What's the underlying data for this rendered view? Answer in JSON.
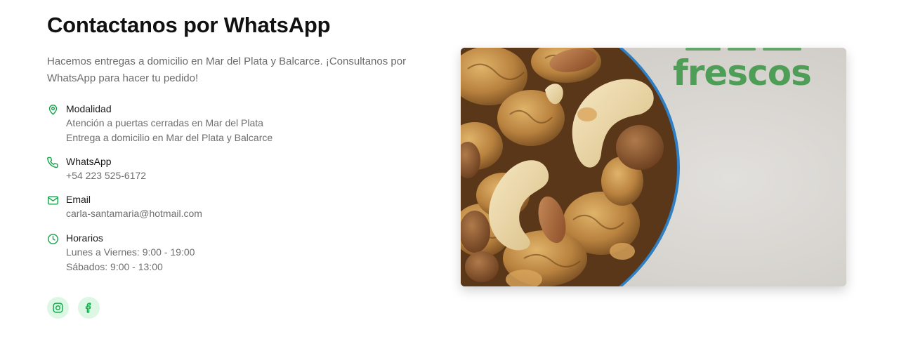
{
  "contact": {
    "title": "Contactanos por WhatsApp",
    "intro": "Hacemos entregas a domicilio en Mar del Plata y Balcarce. ¡Consultanos por WhatsApp para hacer tu pedido!",
    "items": [
      {
        "icon": "map-pin-icon",
        "label": "Modalidad",
        "lines": [
          "Atención a puertas cerradas en Mar del Plata",
          "Entrega a domicilio en Mar del Plata y Balcarce"
        ]
      },
      {
        "icon": "phone-icon",
        "label": "WhatsApp",
        "lines": [
          "+54 223 525-6172"
        ]
      },
      {
        "icon": "mail-icon",
        "label": "Email",
        "lines": [
          "carla-santamaria@hotmail.com"
        ]
      },
      {
        "icon": "clock-icon",
        "label": "Horarios",
        "lines": [
          "Lunes a Viernes: 9:00 - 19:00",
          "Sábados: 9:00 - 13:00"
        ]
      }
    ],
    "socials": [
      {
        "icon": "instagram-icon"
      },
      {
        "icon": "facebook-icon"
      }
    ]
  },
  "image": {
    "caption": "frescos"
  },
  "colors": {
    "accent": "#16a34a",
    "social_bg": "#dcf7e4",
    "caption_green": "#4f9e58",
    "bowl_blue": "#3b8fd0"
  }
}
